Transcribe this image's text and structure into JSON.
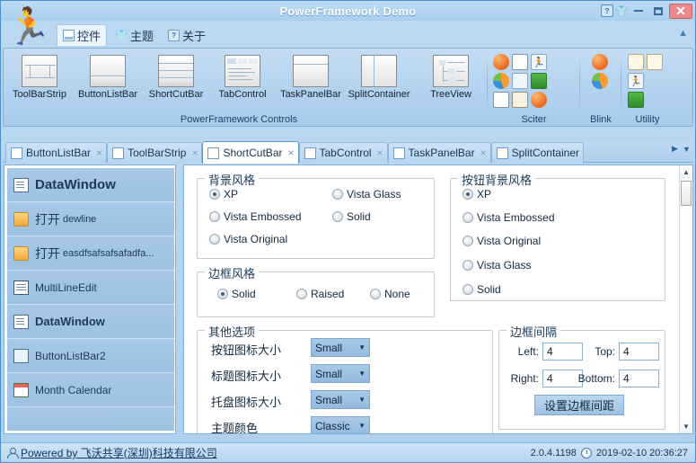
{
  "window": {
    "title": "PowerFramework Demo",
    "buttons": {
      "help": "?",
      "theme": "shirt",
      "minimize": "minimize-icon",
      "maximize": "maximize-icon",
      "close": "✕"
    }
  },
  "menu": {
    "items": [
      {
        "label": "控件",
        "icon": "panel-icon",
        "active": true
      },
      {
        "label": "主题",
        "icon": "shirt-icon",
        "active": false
      },
      {
        "label": "关于",
        "icon": "help-icon",
        "active": false
      }
    ],
    "collapse_icon": "chevron-up-icon"
  },
  "ribbon": {
    "controls_group": {
      "label": "PowerFramework Controls",
      "buttons": [
        {
          "label": "ToolBarStrip",
          "icon": "toolbarstrip-icon"
        },
        {
          "label": "ButtonListBar",
          "icon": "buttonlistbar-icon"
        },
        {
          "label": "ShortCutBar",
          "icon": "shortcutbar-icon"
        },
        {
          "label": "TabControl",
          "icon": "tabcontrol-icon"
        },
        {
          "label": "TaskPanelBar",
          "icon": "taskpanelbar-icon"
        },
        {
          "label": "SplitContainer",
          "icon": "splitcontainer-icon"
        },
        {
          "label": "TreeView",
          "icon": "treeview-icon"
        }
      ]
    },
    "sciter_group": {
      "label": "Sciter",
      "icons": [
        "ball-orange-icon",
        "list-doc-icon",
        "runner-icon",
        "pie-chart-icon",
        "people-icon",
        "green-excel-icon",
        "grid-icon",
        "paint-icon",
        "ball-orange-icon"
      ]
    },
    "blink_group": {
      "label": "Blink",
      "icons": [
        "ball-orange-icon",
        "pie-chart-icon"
      ]
    },
    "utility_group": {
      "label": "Utility",
      "icons": [
        "cake-icon",
        "cake-icon",
        "runner-icon",
        "green-excel-icon"
      ]
    }
  },
  "doc_tabs": {
    "items": [
      {
        "label": "ButtonListBar",
        "selected": false,
        "close": "×"
      },
      {
        "label": "ToolBarStrip",
        "selected": false,
        "close": "×"
      },
      {
        "label": "ShortCutBar",
        "selected": true,
        "close": "×"
      },
      {
        "label": "TabControl",
        "selected": false,
        "close": "×"
      },
      {
        "label": "TaskPanelBar",
        "selected": false,
        "close": "×"
      },
      {
        "label": "SplitContainer",
        "selected": false,
        "close": "×"
      }
    ],
    "nav": {
      "prev": "▶",
      "menu": "▼"
    }
  },
  "sidebar": {
    "items": [
      {
        "label": "DataWindow",
        "icon": "datawindow-icon",
        "style": "header"
      },
      {
        "label_cn": "打开",
        "label_en": "dewline",
        "icon": "folder-open-icon",
        "style": "mixed"
      },
      {
        "label_cn": "打开",
        "label_en": "easdfsafsafsafadfa...",
        "icon": "folder-open-icon",
        "style": "mixed"
      },
      {
        "label": "MultiLineEdit",
        "icon": "multilineedit-icon",
        "style": "normal"
      },
      {
        "label": "DataWindow",
        "icon": "datawindow-icon",
        "style": "bold"
      },
      {
        "label": "ButtonListBar2",
        "icon": "buttonlistbar-icon",
        "style": "normal"
      },
      {
        "label": "Month Calendar",
        "icon": "calendar-icon",
        "style": "normal"
      }
    ]
  },
  "main": {
    "background_style_group": {
      "caption": "背景风格",
      "options": [
        {
          "label": "XP",
          "checked": true
        },
        {
          "label": "Vista Glass",
          "checked": false
        },
        {
          "label": "Vista Embossed",
          "checked": false
        },
        {
          "label": "Solid",
          "checked": false
        },
        {
          "label": "Vista Original",
          "checked": false
        }
      ]
    },
    "border_style_group": {
      "caption": "边框风格",
      "options": [
        {
          "label": "Solid",
          "checked": true
        },
        {
          "label": "Raised",
          "checked": false
        },
        {
          "label": "None",
          "checked": false
        }
      ]
    },
    "button_background_group": {
      "caption": "按钮背景风格",
      "options": [
        {
          "label": "XP",
          "checked": true
        },
        {
          "label": "Vista Embossed",
          "checked": false
        },
        {
          "label": "Vista Original",
          "checked": false
        },
        {
          "label": "Vista Glass",
          "checked": false
        },
        {
          "label": "Solid",
          "checked": false
        }
      ]
    },
    "other_options_group": {
      "caption": "其他选项",
      "rows": [
        {
          "label": "按钮图标大小",
          "value": "Small"
        },
        {
          "label": "标题图标大小",
          "value": "Small"
        },
        {
          "label": "托盘图标大小",
          "value": "Small"
        },
        {
          "label": "主题颜色",
          "value": "Classic"
        }
      ],
      "arrow": "▼"
    },
    "border_spacing_group": {
      "caption": "边框间隔",
      "fields": [
        {
          "label": "Left:",
          "value": "4"
        },
        {
          "label": "Top:",
          "value": "4"
        },
        {
          "label": "Right:",
          "value": "4"
        },
        {
          "label": "Bottom:",
          "value": "4"
        }
      ],
      "apply_button": "设置边框间距"
    },
    "scrollbar": {
      "up": "▲",
      "down": "▼"
    }
  },
  "statusbar": {
    "powered_by": "Powered by 飞沃共享(深圳)科技有限公司",
    "version": "2.0.4.1198",
    "datetime": "2019-02-10 20:36:27"
  },
  "colors": {
    "accent": "#4a90d0",
    "titlebar": "#b4d4f1",
    "sidebar_item": "#a2c4e4",
    "close_button": "#e98a8a"
  }
}
